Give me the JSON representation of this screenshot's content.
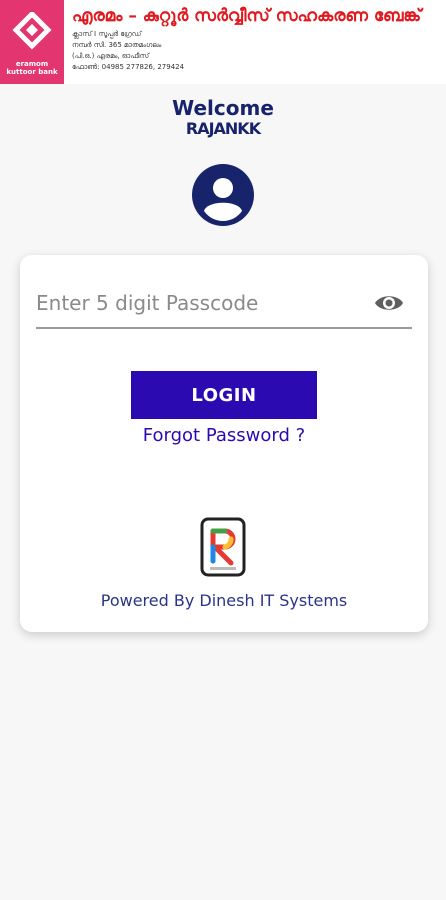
{
  "header": {
    "logo_text_line1": "eramom",
    "logo_text_line2": "kuttoor bank",
    "bank_name": "എരമം – കുറ്റൂർ സർവ്വീസ് സഹകരണ ബേങ്ക്",
    "address_line1": "ക്ലാസ് I സൂപ്പർ ഗ്രേഡ്",
    "address_line2": "നമ്പർ സി. 365 മാതമംഗലം",
    "address_line3": "(പി.ഒ.) എരമം, ഓഫീസ്",
    "address_line4": "ഫോൺ: 04985 277826, 279424"
  },
  "welcome": {
    "title": "Welcome",
    "subtitle": "RAJANKK"
  },
  "login": {
    "passcode_placeholder": "Enter 5 digit Passcode",
    "login_label": "LOGIN",
    "forgot_label": "Forgot Password ?"
  },
  "footer": {
    "powered_by": "Powered By Dinesh IT Systems"
  },
  "colors": {
    "primary": "#2b0bb1",
    "header_pink": "#e3356f",
    "bank_red": "#e0191e",
    "navy": "#17236b"
  },
  "icons": [
    "app-logo-icon",
    "user-avatar-icon",
    "eye-icon",
    "r-brand-logo-icon"
  ]
}
